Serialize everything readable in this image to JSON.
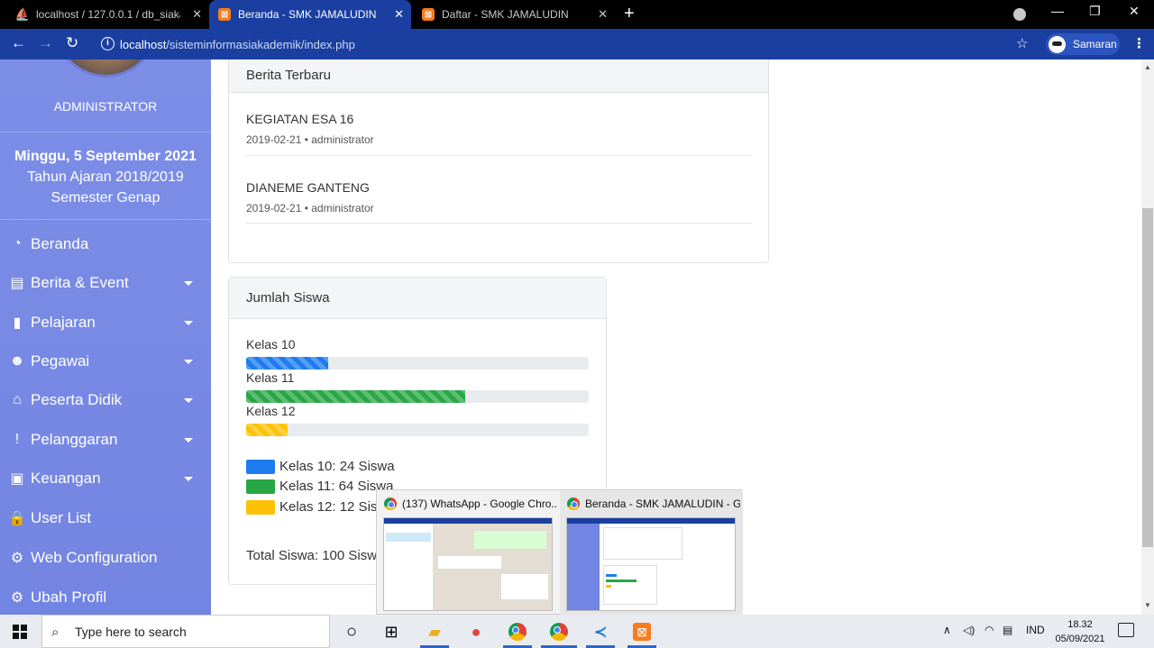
{
  "browser": {
    "tabs": [
      {
        "title": "localhost / 127.0.0.1 / db_siakad",
        "icon": "phpmyadmin-icon"
      },
      {
        "title": "Beranda - SMK JAMALUDIN",
        "icon": "xampp-icon",
        "active": true
      },
      {
        "title": "Daftar - SMK JAMALUDIN",
        "icon": "xampp-icon"
      }
    ],
    "url_host": "localhost",
    "url_path": "/sisteminformasiakademik/index.php",
    "profile_name": "Samaran"
  },
  "sidebar": {
    "role": "ADMINISTRATOR",
    "date": "Minggu, 5 September 2021",
    "school_year": "Tahun Ajaran 2018/2019",
    "semester": "Semester Genap",
    "menu": [
      {
        "label": "Beranda",
        "icon": "dashboard-icon",
        "glyph": "◔",
        "dropdown": false
      },
      {
        "label": "Berita & Event",
        "icon": "newspaper-icon",
        "glyph": "▤",
        "dropdown": true
      },
      {
        "label": "Pelajaran",
        "icon": "book-icon",
        "glyph": "▮",
        "dropdown": true
      },
      {
        "label": "Pegawai",
        "icon": "users-icon",
        "glyph": "☻",
        "dropdown": true
      },
      {
        "label": "Peserta Didik",
        "icon": "graduation-cap-icon",
        "glyph": "⌂",
        "dropdown": true
      },
      {
        "label": "Pelanggaran",
        "icon": "exclamation-circle-icon",
        "glyph": "!",
        "dropdown": true
      },
      {
        "label": "Keuangan",
        "icon": "money-icon",
        "glyph": "▣",
        "dropdown": true
      },
      {
        "label": "User List",
        "icon": "lock-icon",
        "glyph": "🔒",
        "dropdown": false
      },
      {
        "label": "Web Configuration",
        "icon": "gear-icon",
        "glyph": "⚙",
        "dropdown": false
      },
      {
        "label": "Ubah Profil",
        "icon": "gear-icon",
        "glyph": "⚙",
        "dropdown": false
      }
    ]
  },
  "news": {
    "header": "Berita Terbaru",
    "items": [
      {
        "title": "KEGIATAN ESA 16",
        "meta": "2019-02-21 • administrator"
      },
      {
        "title": "DIANEME GANTENG",
        "meta": "2019-02-21 • administrator"
      }
    ]
  },
  "students": {
    "header": "Jumlah Siswa",
    "bars": [
      {
        "label": "Kelas 10",
        "count": 24,
        "color": "#1e7cf0"
      },
      {
        "label": "Kelas 11",
        "count": 64,
        "color": "#28a745"
      },
      {
        "label": "Kelas 12",
        "count": 12,
        "color": "#ffc107"
      }
    ],
    "legend": [
      "Kelas 10: 24 Siswa",
      "Kelas 11: 64 Siswa",
      "Kelas 12: 12 Siswa"
    ],
    "total": "Total Siswa: 100 Siswa"
  },
  "taskbar_popup": [
    {
      "title": "(137) WhatsApp - Google Chro..."
    },
    {
      "title": "Beranda - SMK JAMALUDIN - G..."
    }
  ],
  "taskbar": {
    "search_placeholder": "Type here to search",
    "language": "IND",
    "time": "18.32",
    "date": "05/09/2021"
  }
}
